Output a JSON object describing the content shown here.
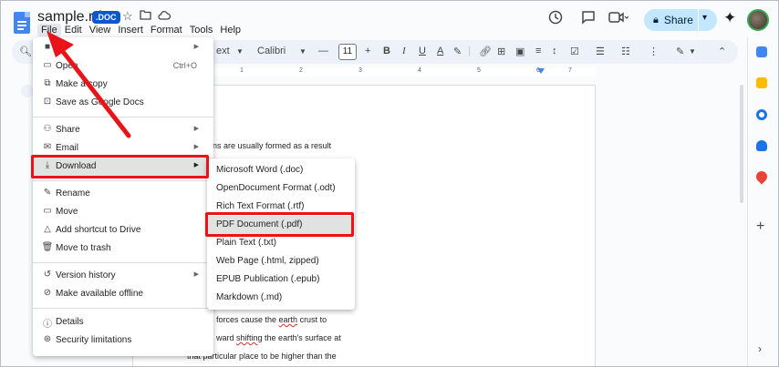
{
  "doc": {
    "title": "sample.rtf",
    "badge": ".DOC"
  },
  "menubar": [
    "File",
    "Edit",
    "View",
    "Insert",
    "Format",
    "Tools",
    "Help"
  ],
  "share": {
    "label": "Share"
  },
  "toolbar": {
    "style_label": "ext",
    "font_label": "Calibri",
    "font_size": "11"
  },
  "ruler": [
    "1",
    "2",
    "3",
    "4",
    "5",
    "6",
    "7"
  ],
  "document_lines": [
    "ns are usually formed as a result",
    "forces cause the ",
    "earth",
    " crust to",
    "ward ",
    "shifting",
    " the earth's surface at",
    "that particular place to be higher than the"
  ],
  "file_menu": {
    "items": [
      {
        "label": "",
        "icon": "document-icon"
      },
      {
        "label": "Open",
        "shortcut": "Ctrl+O",
        "icon": "folder-icon"
      },
      {
        "label": "Make a copy",
        "icon": "copy-icon"
      },
      {
        "label": "Save as Google Docs",
        "icon": "save-icon"
      },
      {
        "label": "Share",
        "icon": "person-add-icon"
      },
      {
        "label": "Email",
        "icon": "email-icon"
      },
      {
        "label": "Download",
        "icon": "download-icon"
      },
      {
        "label": "Rename",
        "icon": "pencil-icon"
      },
      {
        "label": "Move",
        "icon": "move-folder-icon"
      },
      {
        "label": "Add shortcut to Drive",
        "icon": "drive-shortcut-icon"
      },
      {
        "label": "Move to trash",
        "icon": "trash-icon"
      },
      {
        "label": "Version history",
        "icon": "history-icon"
      },
      {
        "label": "Make available offline",
        "icon": "offline-icon"
      },
      {
        "label": "Details",
        "icon": "info-icon"
      },
      {
        "label": "Security limitations",
        "icon": "security-icon"
      }
    ]
  },
  "download_menu": {
    "items": [
      "Microsoft Word (.doc)",
      "OpenDocument Format (.odt)",
      "Rich Text Format (.rtf)",
      "PDF Document (.pdf)",
      "Plain Text (.txt)",
      "Web Page (.html, zipped)",
      "EPUB Publication (.epub)",
      "Markdown (.md)"
    ]
  },
  "colors": {
    "accent": "#0b57d0",
    "share_bg": "#c2e7ff",
    "highlight_box": "#e8141a",
    "menu_hover": "#e1e3e1"
  }
}
